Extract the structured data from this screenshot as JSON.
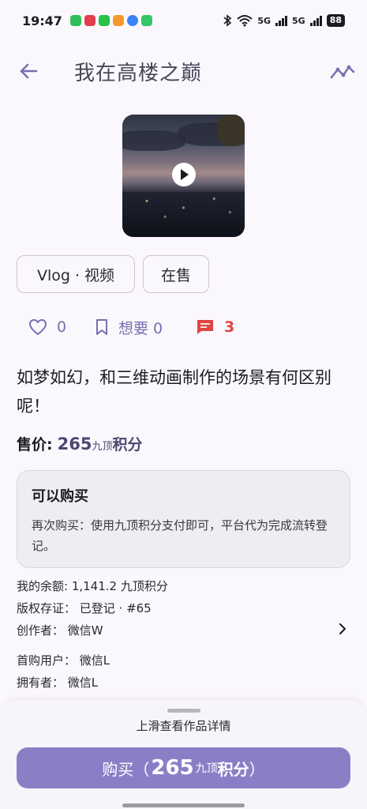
{
  "status_bar": {
    "time": "19:47",
    "network_1": "5G",
    "network_2": "5G",
    "battery": "88"
  },
  "header": {
    "title": "我在高楼之巅"
  },
  "tags": {
    "category": "Vlog · 视频",
    "status": "在售"
  },
  "stats": {
    "likes": "0",
    "want_label": "想要 0",
    "comments": "3"
  },
  "description": "如梦如幻，和三维动画制作的场景有何区别呢！",
  "price": {
    "label": "售价:",
    "amount": "265",
    "unit_small": "九顶",
    "unit": "积分"
  },
  "purchase_card": {
    "title": "可以购买",
    "body": "再次购买：使用九顶积分支付即可，平台代为完成流转登记。"
  },
  "info": {
    "balance": "我的余额: 1,141.2 九顶积分",
    "copyright": "版权存证：  已登记 · #65",
    "creator": "创作者：  微信W",
    "first_buyer": "首购用户：  微信L",
    "owner": "拥有者：  微信L"
  },
  "bottom_sheet": {
    "hint": "上滑查看作品详情",
    "buy_prefix": "购买（",
    "buy_amount": "265",
    "buy_unit_small": "九顶",
    "buy_unit": "积分",
    "buy_suffix": "）"
  },
  "colors": {
    "accent": "#8a7fc6",
    "comment_red": "#e0453f",
    "card_bg": "#efedf2"
  }
}
